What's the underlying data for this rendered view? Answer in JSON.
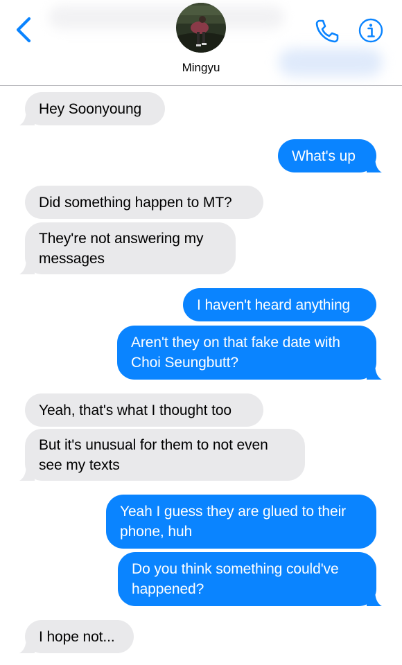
{
  "header": {
    "contact_name": "Mingyu",
    "back_icon": "chevron-left-icon",
    "call_icon": "phone-icon",
    "info_icon": "info-icon",
    "accent_color": "#0a84ff"
  },
  "messages": [
    {
      "side": "received",
      "text": "Hey Soonyoung"
    },
    {
      "side": "sent",
      "text": "What's up"
    },
    {
      "side": "received",
      "text": "Did something happen to MT?"
    },
    {
      "side": "received",
      "text": "They're not answering my messages"
    },
    {
      "side": "sent",
      "text": "I haven't heard anything"
    },
    {
      "side": "sent",
      "text": "Aren't they on that fake date with Choi Seungbutt?"
    },
    {
      "side": "received",
      "text": "Yeah, that's what I thought too"
    },
    {
      "side": "received",
      "text": "But it's unusual for them to not even see my texts"
    },
    {
      "side": "sent",
      "text": "Yeah I guess they are glued to their phone, huh"
    },
    {
      "side": "sent",
      "text": "Do you think something could've happened?"
    },
    {
      "side": "received",
      "text": "I hope not..."
    }
  ],
  "colors": {
    "sent_bubble": "#0a84ff",
    "received_bubble": "#e9e9eb"
  }
}
